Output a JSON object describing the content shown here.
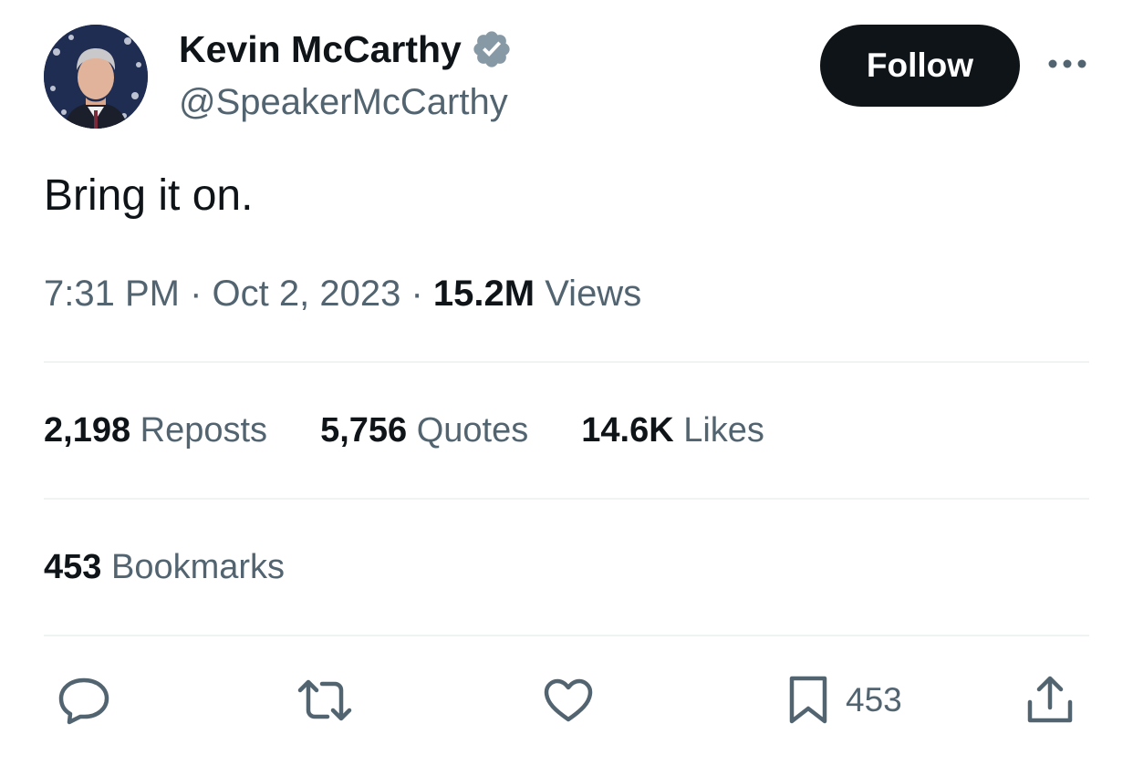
{
  "author": {
    "display_name": "Kevin McCarthy",
    "handle": "@SpeakerMcCarthy",
    "verified": true,
    "verified_badge_color": "#8899a6",
    "avatar_icon": "profile-photo"
  },
  "header": {
    "follow_label": "Follow",
    "more_icon": "more-horizontal-icon"
  },
  "tweet": {
    "text": "Bring it on.",
    "time": "7:31 PM",
    "date": "Oct 2, 2023",
    "separator": "·",
    "views_count": "15.2M",
    "views_label": "Views"
  },
  "stats": {
    "reposts_count": "2,198",
    "reposts_label": "Reposts",
    "quotes_count": "5,756",
    "quotes_label": "Quotes",
    "likes_count": "14.6K",
    "likes_label": "Likes",
    "bookmarks_count": "453",
    "bookmarks_label": "Bookmarks"
  },
  "actions": {
    "reply_icon": "reply-icon",
    "repost_icon": "repost-icon",
    "like_icon": "heart-icon",
    "bookmark_icon": "bookmark-icon",
    "bookmark_count": "453",
    "share_icon": "share-icon"
  },
  "colors": {
    "text_primary": "#0f1419",
    "text_secondary": "#536471",
    "divider": "#eff3f4",
    "button_bg": "#0f1419",
    "button_text": "#ffffff"
  }
}
